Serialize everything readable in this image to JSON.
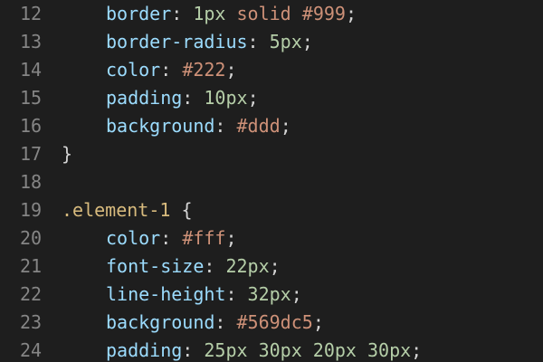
{
  "editor": {
    "background": "#1e1e1e",
    "colors": {
      "line_number": "#858585",
      "property": "#9cdcfe",
      "number": "#b5cea8",
      "value": "#ce9178",
      "selector": "#d7ba7d",
      "punctuation": "#d4d4d4"
    },
    "lines": [
      {
        "number": "12",
        "indent": true,
        "tokens": [
          {
            "text": "border",
            "kind": "property"
          },
          {
            "text": ": ",
            "kind": "punct"
          },
          {
            "text": "1px",
            "kind": "number"
          },
          {
            "text": " ",
            "kind": "punct"
          },
          {
            "text": "solid",
            "kind": "keyword"
          },
          {
            "text": " ",
            "kind": "punct"
          },
          {
            "text": "#999",
            "kind": "color"
          },
          {
            "text": ";",
            "kind": "punct"
          }
        ]
      },
      {
        "number": "13",
        "indent": true,
        "tokens": [
          {
            "text": "border-radius",
            "kind": "property"
          },
          {
            "text": ": ",
            "kind": "punct"
          },
          {
            "text": "5px",
            "kind": "number"
          },
          {
            "text": ";",
            "kind": "punct"
          }
        ]
      },
      {
        "number": "14",
        "indent": true,
        "tokens": [
          {
            "text": "color",
            "kind": "property"
          },
          {
            "text": ": ",
            "kind": "punct"
          },
          {
            "text": "#222",
            "kind": "color"
          },
          {
            "text": ";",
            "kind": "punct"
          }
        ]
      },
      {
        "number": "15",
        "indent": true,
        "tokens": [
          {
            "text": "padding",
            "kind": "property"
          },
          {
            "text": ": ",
            "kind": "punct"
          },
          {
            "text": "10px",
            "kind": "number"
          },
          {
            "text": ";",
            "kind": "punct"
          }
        ]
      },
      {
        "number": "16",
        "indent": true,
        "tokens": [
          {
            "text": "background",
            "kind": "property"
          },
          {
            "text": ": ",
            "kind": "punct"
          },
          {
            "text": "#ddd",
            "kind": "color"
          },
          {
            "text": ";",
            "kind": "punct"
          }
        ]
      },
      {
        "number": "17",
        "indent": false,
        "tokens": [
          {
            "text": "}",
            "kind": "punct"
          }
        ]
      },
      {
        "number": "18",
        "indent": false,
        "tokens": []
      },
      {
        "number": "19",
        "indent": false,
        "tokens": [
          {
            "text": ".element-1",
            "kind": "selector"
          },
          {
            "text": " {",
            "kind": "punct"
          }
        ]
      },
      {
        "number": "20",
        "indent": true,
        "tokens": [
          {
            "text": "color",
            "kind": "property"
          },
          {
            "text": ": ",
            "kind": "punct"
          },
          {
            "text": "#fff",
            "kind": "color"
          },
          {
            "text": ";",
            "kind": "punct"
          }
        ]
      },
      {
        "number": "21",
        "indent": true,
        "tokens": [
          {
            "text": "font-size",
            "kind": "property"
          },
          {
            "text": ": ",
            "kind": "punct"
          },
          {
            "text": "22px",
            "kind": "number"
          },
          {
            "text": ";",
            "kind": "punct"
          }
        ]
      },
      {
        "number": "22",
        "indent": true,
        "tokens": [
          {
            "text": "line-height",
            "kind": "property"
          },
          {
            "text": ": ",
            "kind": "punct"
          },
          {
            "text": "32px",
            "kind": "number"
          },
          {
            "text": ";",
            "kind": "punct"
          }
        ]
      },
      {
        "number": "23",
        "indent": true,
        "tokens": [
          {
            "text": "background",
            "kind": "property"
          },
          {
            "text": ": ",
            "kind": "punct"
          },
          {
            "text": "#569dc5",
            "kind": "color"
          },
          {
            "text": ";",
            "kind": "punct"
          }
        ]
      },
      {
        "number": "24",
        "indent": true,
        "tokens": [
          {
            "text": "padding",
            "kind": "property"
          },
          {
            "text": ": ",
            "kind": "punct"
          },
          {
            "text": "25px 30px 20px 30px",
            "kind": "number"
          },
          {
            "text": ";",
            "kind": "punct"
          }
        ]
      }
    ]
  }
}
